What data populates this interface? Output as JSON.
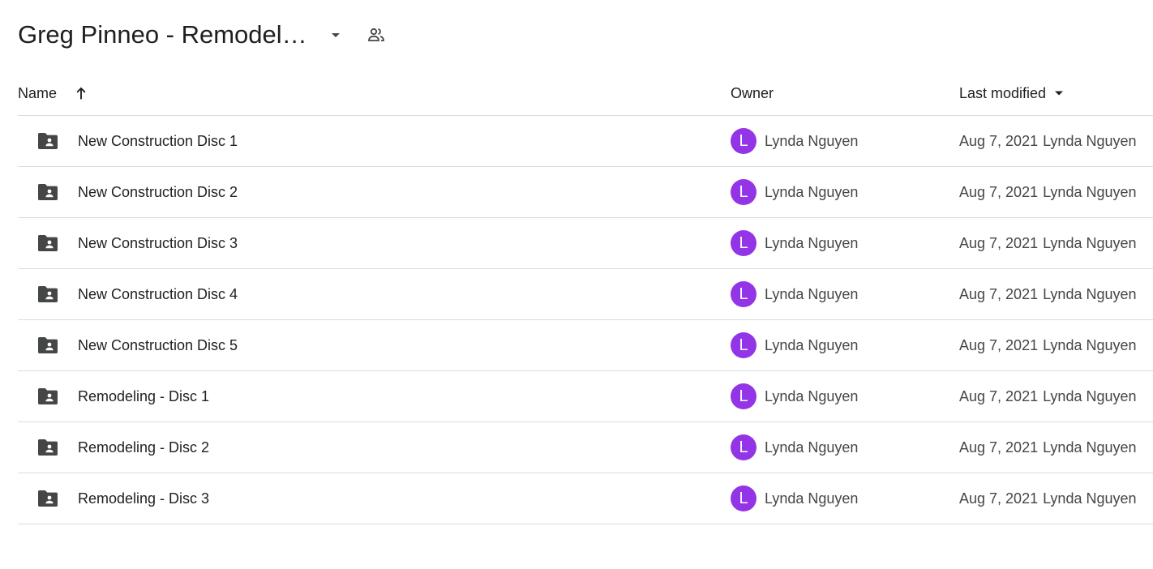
{
  "header": {
    "title": "Greg Pinneo - Remodeling",
    "dropdown_icon": "arrow-drop-down-icon",
    "shared_icon": "people-icon"
  },
  "columns": {
    "name": "Name",
    "owner": "Owner",
    "modified": "Last modified"
  },
  "colors": {
    "avatar_bg": "#9334e6",
    "folder_icon": "#444746",
    "divider": "#dadce0"
  },
  "rows": [
    {
      "name": "New Construction Disc 1",
      "owner": "Lynda Nguyen",
      "owner_initial": "L",
      "modified_date": "Aug 7, 2021",
      "modified_by": "Lynda Nguyen"
    },
    {
      "name": "New Construction Disc 2",
      "owner": "Lynda Nguyen",
      "owner_initial": "L",
      "modified_date": "Aug 7, 2021",
      "modified_by": "Lynda Nguyen"
    },
    {
      "name": "New Construction Disc 3",
      "owner": "Lynda Nguyen",
      "owner_initial": "L",
      "modified_date": "Aug 7, 2021",
      "modified_by": "Lynda Nguyen"
    },
    {
      "name": "New Construction Disc 4",
      "owner": "Lynda Nguyen",
      "owner_initial": "L",
      "modified_date": "Aug 7, 2021",
      "modified_by": "Lynda Nguyen"
    },
    {
      "name": "New Construction Disc 5",
      "owner": "Lynda Nguyen",
      "owner_initial": "L",
      "modified_date": "Aug 7, 2021",
      "modified_by": "Lynda Nguyen"
    },
    {
      "name": "Remodeling - Disc 1",
      "owner": "Lynda Nguyen",
      "owner_initial": "L",
      "modified_date": "Aug 7, 2021",
      "modified_by": "Lynda Nguyen"
    },
    {
      "name": "Remodeling - Disc 2",
      "owner": "Lynda Nguyen",
      "owner_initial": "L",
      "modified_date": "Aug 7, 2021",
      "modified_by": "Lynda Nguyen"
    },
    {
      "name": "Remodeling - Disc 3",
      "owner": "Lynda Nguyen",
      "owner_initial": "L",
      "modified_date": "Aug 7, 2021",
      "modified_by": "Lynda Nguyen"
    }
  ]
}
